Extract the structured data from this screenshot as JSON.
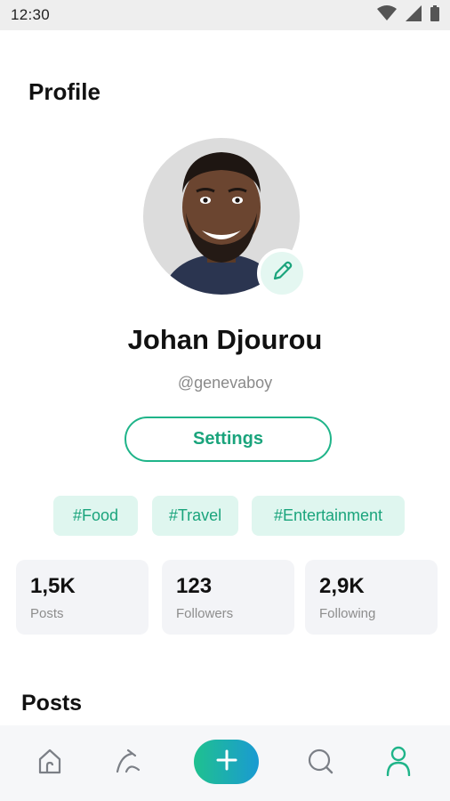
{
  "status_bar": {
    "time": "12:30",
    "icons": [
      "wifi-icon",
      "signal-icon",
      "battery-icon"
    ]
  },
  "page_title": "Profile",
  "profile": {
    "name": "Johan Djourou",
    "handle": "@genevaboy",
    "avatar_icon": "avatar-photo",
    "edit_icon": "pencil-icon"
  },
  "settings_button": {
    "label": "Settings"
  },
  "tags": [
    "#Food",
    "#Travel",
    "#Entertainment"
  ],
  "stats": [
    {
      "value": "1,5K",
      "label": "Posts"
    },
    {
      "value": "123",
      "label": "Followers"
    },
    {
      "value": "2,9K",
      "label": "Following"
    }
  ],
  "posts_section": {
    "title": "Posts"
  },
  "bottom_nav": {
    "items": [
      "home-icon",
      "explore-icon",
      "add-icon",
      "search-icon",
      "profile-icon"
    ],
    "active": "profile-icon"
  },
  "colors": {
    "accent": "#1fb489",
    "accent_light": "#dff6ef",
    "fab_start": "#1fc18f",
    "fab_end": "#1a9ad2"
  }
}
